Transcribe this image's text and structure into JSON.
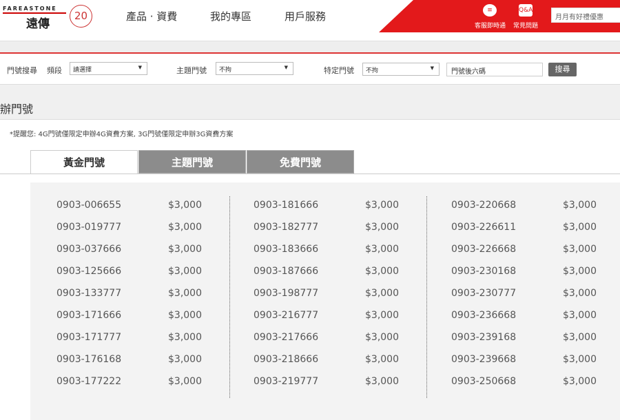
{
  "header": {
    "logo_en": "FAREASTONE",
    "logo_zh": "遠傳",
    "anniversary": "20th",
    "nav": [
      "產品 · 資費",
      "我的專區",
      "用戶服務"
    ],
    "icons": [
      {
        "name": "chat-icon",
        "label": "客服即時通"
      },
      {
        "name": "qa-icon",
        "label": "常見問題",
        "glyph": "Q&A"
      }
    ],
    "search_placeholder": "月月有好禮優惠",
    "brand_color": "#e3191b"
  },
  "search": {
    "title": "門號搜尋",
    "segment_label": "頻段",
    "segment_value": "請選擇",
    "theme_label": "主題門號",
    "theme_value": "不拘",
    "specific_label": "特定門號",
    "specific_value": "不拘",
    "input_placeholder": "門號後六碼",
    "button": "搜尋"
  },
  "section_title": "辦門號",
  "note": "*提醒您: 4G門號僅限定申辦4G資費方案, 3G門號僅限定申辦3G資費方案",
  "tabs": [
    "黃金門號",
    "主題門號",
    "免費門號"
  ],
  "columns": [
    [
      [
        "0903-006655",
        "$3,000"
      ],
      [
        "0903-019777",
        "$3,000"
      ],
      [
        "0903-037666",
        "$3,000"
      ],
      [
        "0903-125666",
        "$3,000"
      ],
      [
        "0903-133777",
        "$3,000"
      ],
      [
        "0903-171666",
        "$3,000"
      ],
      [
        "0903-171777",
        "$3,000"
      ],
      [
        "0903-176168",
        "$3,000"
      ],
      [
        "0903-177222",
        "$3,000"
      ]
    ],
    [
      [
        "0903-181666",
        "$3,000"
      ],
      [
        "0903-182777",
        "$3,000"
      ],
      [
        "0903-183666",
        "$3,000"
      ],
      [
        "0903-187666",
        "$3,000"
      ],
      [
        "0903-198777",
        "$3,000"
      ],
      [
        "0903-216777",
        "$3,000"
      ],
      [
        "0903-217666",
        "$3,000"
      ],
      [
        "0903-218666",
        "$3,000"
      ],
      [
        "0903-219777",
        "$3,000"
      ]
    ],
    [
      [
        "0903-220668",
        "$3,000"
      ],
      [
        "0903-226611",
        "$3,000"
      ],
      [
        "0903-226668",
        "$3,000"
      ],
      [
        "0903-230168",
        "$3,000"
      ],
      [
        "0903-230777",
        "$3,000"
      ],
      [
        "0903-236668",
        "$3,000"
      ],
      [
        "0903-239168",
        "$3,000"
      ],
      [
        "0903-239668",
        "$3,000"
      ],
      [
        "0903-250668",
        "$3,000"
      ]
    ]
  ]
}
